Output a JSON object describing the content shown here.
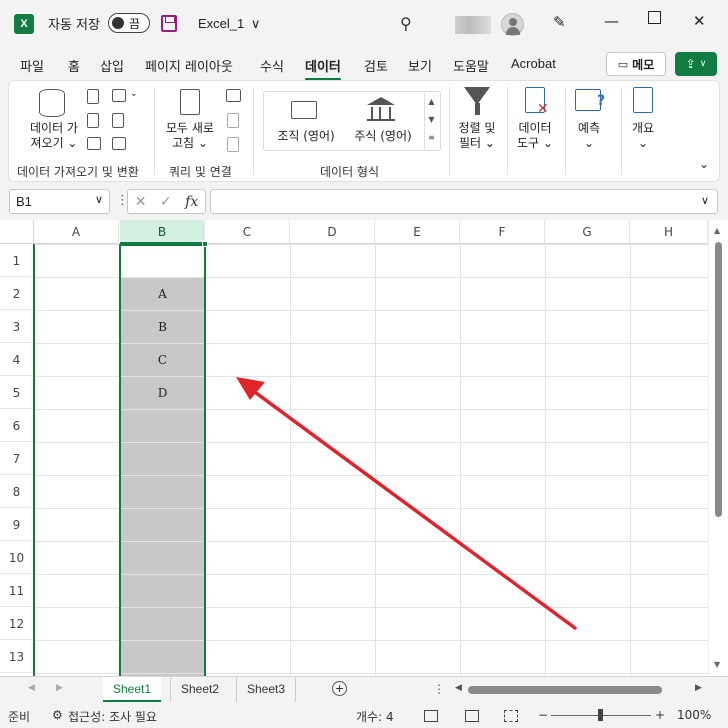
{
  "titlebar": {
    "app_icon": "excel-logo",
    "autosave_label": "자동 저장",
    "autosave_state": "끔",
    "filename": "Excel_1",
    "filename_chevron": "∨"
  },
  "tabs": [
    {
      "label": "파일"
    },
    {
      "label": "홈"
    },
    {
      "label": "삽입"
    },
    {
      "label": "페이지 레이아웃"
    },
    {
      "label": "수식"
    },
    {
      "label": "데이터",
      "active": true
    },
    {
      "label": "검토"
    },
    {
      "label": "보기"
    },
    {
      "label": "도움말"
    },
    {
      "label": "Acrobat"
    }
  ],
  "memo_button": "메모",
  "ribbon": {
    "get_data_line1": "데이터 가",
    "get_data_line2": "져오기 ⌄",
    "group_get_transform": "데이터 가져오기 및 변환",
    "refresh_line1": "모두 새로",
    "refresh_line2": "고침 ⌄",
    "group_queries": "쿼리 및 연결",
    "stocks": "조직 (영어)",
    "currencies": "주식 (영어)",
    "group_data_types": "데이터 형식",
    "sort_filter_line1": "정렬 및",
    "sort_filter_line2": "필터 ⌄",
    "data_tools_line1": "데이터",
    "data_tools_line2": "도구 ⌄",
    "forecast_label": "예측",
    "forecast_chev": "⌄",
    "outline_label": "개요",
    "outline_chev": "⌄"
  },
  "formula_bar": {
    "name_box": "B1",
    "fx": "fx",
    "cancel_glyph": "✕",
    "enter_glyph": "✓",
    "formula": ""
  },
  "grid": {
    "columns": [
      "A",
      "B",
      "C",
      "D",
      "E",
      "F",
      "G",
      "H"
    ],
    "selected_column": "B",
    "rows": [
      "1",
      "2",
      "3",
      "4",
      "5",
      "6",
      "7",
      "8",
      "9",
      "10",
      "11",
      "12",
      "13"
    ],
    "column_b_values": [
      "",
      "A",
      "B",
      "C",
      "D",
      "",
      "",
      "",
      "",
      "",
      "",
      "",
      ""
    ]
  },
  "sheets": [
    {
      "label": "Sheet1",
      "active": true
    },
    {
      "label": "Sheet2"
    },
    {
      "label": "Sheet3"
    }
  ],
  "statusbar": {
    "ready": "준비",
    "accessibility": "접근성: 조사 필요",
    "count": "개수: 4",
    "zoom_minus": "−",
    "zoom_plus": "+",
    "zoom": "100%"
  },
  "annotation": {
    "arrow_color": "#e0242b",
    "arrow_points_to": "column-B-cells"
  },
  "colors": {
    "accent": "#107c41",
    "selection_fill": "#c8c8c8"
  }
}
